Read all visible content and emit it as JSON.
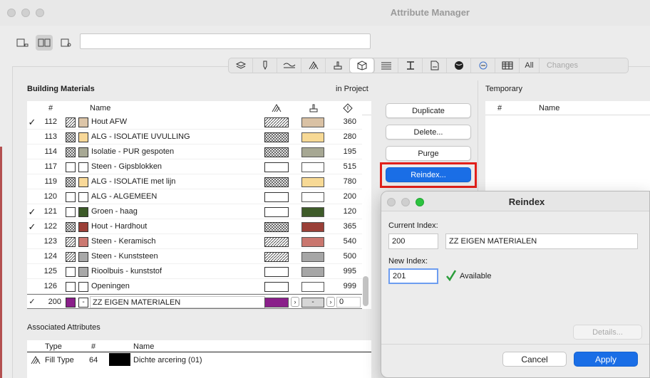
{
  "window": {
    "title": "Attribute Manager"
  },
  "toolbar": {
    "view_buttons": [
      {
        "name": "left-panel-view-icon"
      },
      {
        "name": "dual-panel-view-icon"
      },
      {
        "name": "right-panel-view-icon"
      }
    ],
    "search_value": ""
  },
  "tabs": [
    {
      "icon": "layers-icon"
    },
    {
      "icon": "pen-icon"
    },
    {
      "icon": "line-type-icon"
    },
    {
      "icon": "fill-icon"
    },
    {
      "icon": "surface-icon"
    },
    {
      "icon": "building-material-icon"
    },
    {
      "icon": "composite-icon"
    },
    {
      "icon": "profile-icon"
    },
    {
      "icon": "zone-category-icon"
    },
    {
      "icon": "mep-system-icon"
    },
    {
      "icon": "renovation-icon"
    },
    {
      "icon": "property-table-icon"
    }
  ],
  "tab_text": {
    "all": "All",
    "changes": "Changes"
  },
  "left": {
    "title": "Building Materials",
    "in_project": "in Project",
    "header": {
      "num": "#",
      "name": "Name"
    },
    "rows": [
      {
        "check": "✓",
        "num": "112",
        "name": "Hout AFW",
        "count": "360",
        "hatch": "diag",
        "color": "#dcc5a8",
        "fill": "#d9c1a4"
      },
      {
        "check": "",
        "num": "113",
        "name": "ALG - ISOLATIE UVULLING",
        "count": "280",
        "hatch": "cross",
        "color": "#f8d898",
        "fill": "#f7d995"
      },
      {
        "check": "",
        "num": "114",
        "name": "Isolatie - PUR gespoten",
        "count": "195",
        "hatch": "cross",
        "color": "#a7a894",
        "fill": "#a6a793"
      },
      {
        "check": "",
        "num": "117",
        "name": "Steen - Gipsblokken",
        "count": "515",
        "hatch": "none",
        "color": "#ffffff",
        "fill": "#ffffff"
      },
      {
        "check": "",
        "num": "119",
        "name": "ALG - ISOLATIE met lijn",
        "count": "780",
        "hatch": "cross",
        "color": "#f8d898",
        "fill": "#f7d995"
      },
      {
        "check": "",
        "num": "120",
        "name": "ALG - ALGEMEEN",
        "count": "200",
        "hatch": "none",
        "color": "#ffffff",
        "fill": "#ffffff"
      },
      {
        "check": "✓",
        "num": "121",
        "name": "Groen - haag",
        "count": "120",
        "hatch": "none",
        "color": "#3c5a28",
        "fill": "#3e5b29"
      },
      {
        "check": "✓",
        "num": "122",
        "name": "Hout - Hardhout",
        "count": "365",
        "hatch": "cross",
        "color": "#9c4038",
        "fill": "#9a3f37"
      },
      {
        "check": "",
        "num": "123",
        "name": "Steen - Keramisch",
        "count": "540",
        "hatch": "diag",
        "color": "#cb7870",
        "fill": "#c9766e"
      },
      {
        "check": "",
        "num": "124",
        "name": "Steen - Kunststeen",
        "count": "500",
        "hatch": "diag",
        "color": "#a8a8a8",
        "fill": "#a6a6a6"
      },
      {
        "check": "",
        "num": "125",
        "name": "Rioolbuis - kunststof",
        "count": "995",
        "hatch": "none",
        "color": "#a8a8a8",
        "fill": "#a6a6a6"
      },
      {
        "check": "",
        "num": "126",
        "name": "Openingen",
        "count": "999",
        "hatch": "none",
        "color": "#ffffff",
        "fill": "#ffffff"
      }
    ],
    "edit_row": {
      "check": "✓",
      "num": "200",
      "name": "ZZ EIGEN MATERIALEN",
      "count": "0",
      "color": "#8a1f8a",
      "dash": "-"
    }
  },
  "buttons": {
    "duplicate": "Duplicate",
    "delete": "Delete...",
    "purge": "Purge",
    "reindex": "Reindex..."
  },
  "right": {
    "title": "Temporary",
    "header": {
      "num": "#",
      "name": "Name"
    }
  },
  "assoc": {
    "title": "Associated Attributes",
    "header": {
      "type": "Type",
      "num": "#",
      "name": "Name"
    },
    "rows": [
      {
        "type": "Fill Type",
        "num": "64",
        "name": "Dichte arcering (01)"
      }
    ]
  },
  "dialog": {
    "title": "Reindex",
    "current_label": "Current Index:",
    "current_index": "200",
    "current_name": "ZZ EIGEN MATERIALEN",
    "new_label": "New Index:",
    "new_index": "201",
    "status": "Available",
    "details": "Details...",
    "cancel": "Cancel",
    "apply": "Apply"
  },
  "colors": {
    "accent": "#1a6ee6",
    "highlight": "#e1201a",
    "ok": "#2a9d3a"
  }
}
